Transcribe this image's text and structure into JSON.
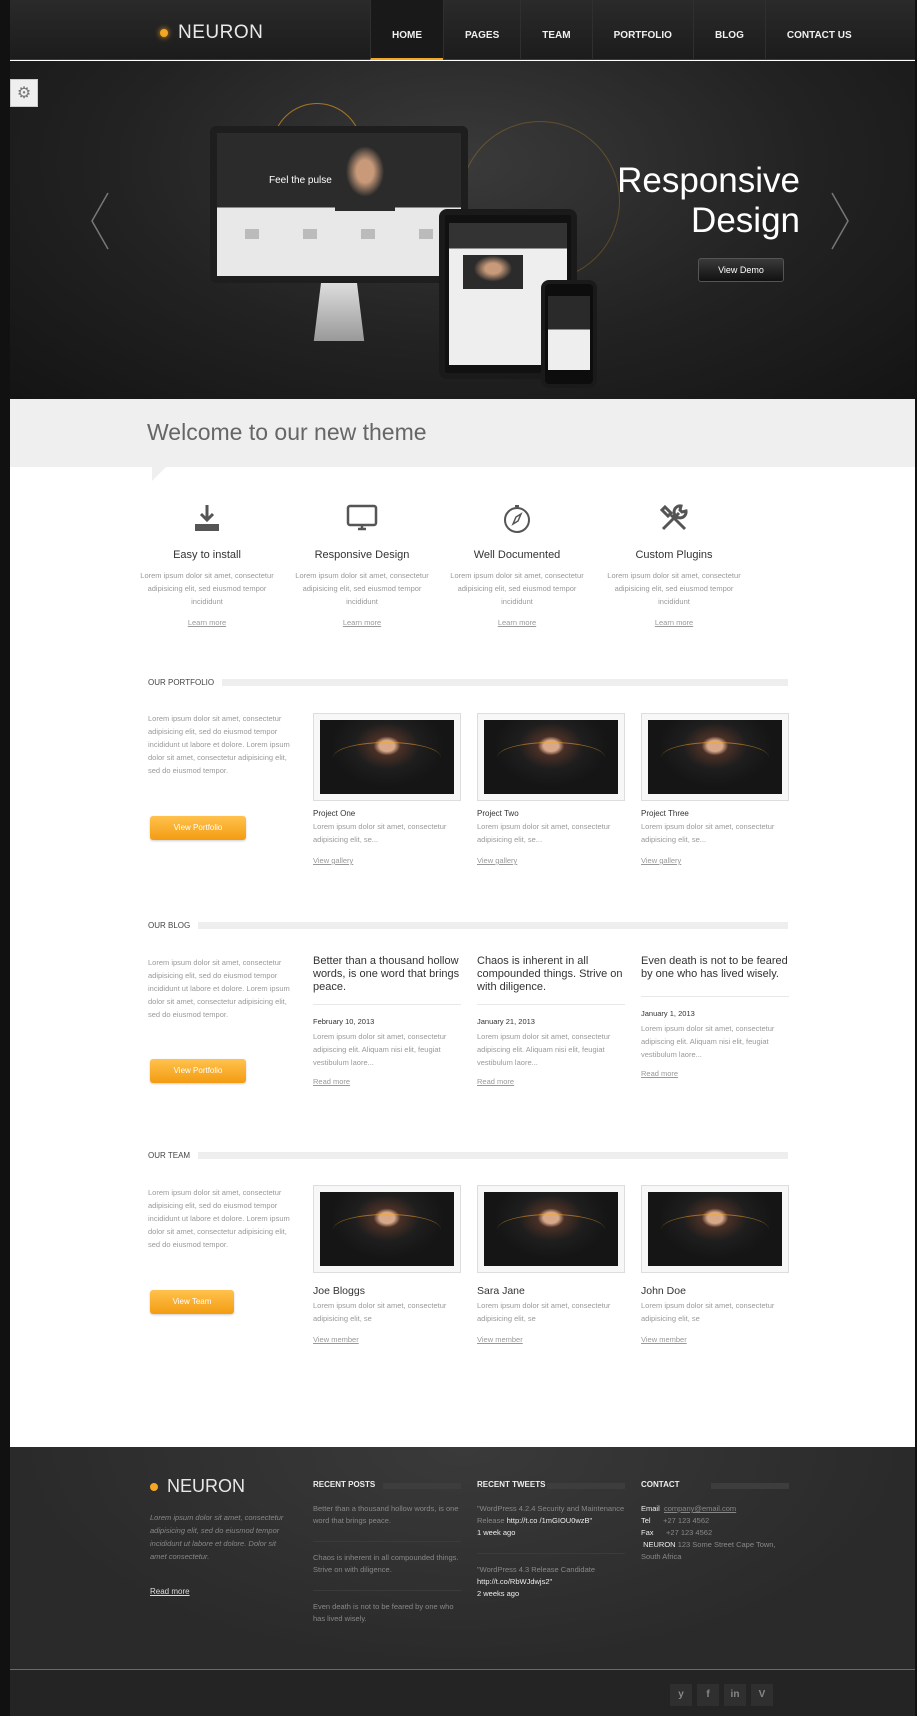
{
  "header": {
    "logo": "NEURON",
    "nav": [
      "HOME",
      "PAGES",
      "TEAM",
      "PORTFOLIO",
      "BLOG",
      "CONTACT US"
    ],
    "active_nav": "HOME"
  },
  "hero": {
    "title_line1": "Responsive",
    "title_line2": "Design",
    "button": "View Demo",
    "monitor_text": "Feel the pulse"
  },
  "welcome": {
    "title": "Welcome to our new theme"
  },
  "features": [
    {
      "title": "Easy to install",
      "text": "Lorem ipsum dolor sit amet, consectetur adipisicing elit, sed eiusmod tempor incididunt",
      "link": "Learn more",
      "icon": "download-icon"
    },
    {
      "title": "Responsive Design",
      "text": "Lorem ipsum dolor sit amet, consectetur adipisicing elit, sed eiusmod tempor incididunt",
      "link": "Learn more",
      "icon": "monitor-icon"
    },
    {
      "title": "Well Documented",
      "text": "Lorem ipsum dolor sit amet, consectetur adipisicing elit, sed eiusmod tempor incididunt",
      "link": "Learn more",
      "icon": "compass-icon"
    },
    {
      "title": "Custom Plugins",
      "text": "Lorem ipsum dolor sit amet, consectetur adipisicing elit, sed eiusmod tempor incididunt",
      "link": "Learn more",
      "icon": "tools-icon"
    }
  ],
  "portfolio": {
    "heading": "OUR PORTFOLIO",
    "intro": "Lorem ipsum dolor sit amet, consectetur adipisicing elit, sed do eiusmod tempor incididunt ut labore et dolore. Lorem ipsum dolor sit amet, consectetur adipisicing elit, sed do eiusmod tempor.",
    "button": "View Portfolio",
    "items": [
      {
        "name": "Project One",
        "text": "Lorem ipsum dolor sit amet, consectetur adipisicing elit, se...",
        "link": "View gallery"
      },
      {
        "name": "Project Two",
        "text": "Lorem ipsum dolor sit amet, consectetur adipisicing elit, se...",
        "link": "View gallery"
      },
      {
        "name": "Project Three",
        "text": "Lorem ipsum dolor sit amet, consectetur adipisicing elit, se...",
        "link": "View gallery"
      }
    ]
  },
  "blog": {
    "heading": "OUR BLOG",
    "intro": "Lorem ipsum dolor sit amet, consectetur adipisicing elit, sed do eiusmod tempor incididunt ut labore et dolore. Lorem ipsum dolor sit amet, consectetur adipisicing elit, sed do eiusmod tempor.",
    "button": "View Portfolio",
    "posts": [
      {
        "title": "Better than a thousand hollow words, is one word that brings peace.",
        "date": "February 10, 2013",
        "text": "Lorem ipsum dolor sit amet, consectetur adipiscing elit. Aliquam nisi elit, feugiat vestibulum laore...",
        "link": "Read more"
      },
      {
        "title": "Chaos is inherent in all compounded things. Strive on with diligence.",
        "date": "January 21, 2013",
        "text": "Lorem ipsum dolor sit amet, consectetur adipiscing elit. Aliquam nisi elit, feugiat vestibulum laore...",
        "link": "Read more"
      },
      {
        "title": "Even death is not to be feared by one who has lived wisely.",
        "date": "January 1, 2013",
        "text": "Lorem ipsum dolor sit amet, consectetur adipiscing elit. Aliquam nisi elit, feugiat vestibulum laore...",
        "link": "Read more"
      }
    ]
  },
  "team": {
    "heading": "OUR TEAM",
    "intro": "Lorem ipsum dolor sit amet, consectetur adipisicing elit, sed do eiusmod tempor incididunt ut labore et dolore. Lorem ipsum dolor sit amet, consectetur adipisicing elit, sed do eiusmod tempor.",
    "button": "View Team",
    "members": [
      {
        "name": "Joe Bloggs",
        "text": "Lorem ipsum dolor sit amet, consectetur adipisicing elit, se",
        "link": "View member"
      },
      {
        "name": "Sara Jane",
        "text": "Lorem ipsum dolor sit amet, consectetur adipisicing elit, se",
        "link": "View member"
      },
      {
        "name": "John Doe",
        "text": "Lorem ipsum dolor sit amet, consectetur adipisicing elit, se",
        "link": "View member"
      }
    ]
  },
  "footer": {
    "logo": "NEURON",
    "about": "Lorem ipsum dolor sit amet, consectetur adipisicing elit, sed do eiusmod tempor incididunt ut labore et dolore. Dolor sit amet consectetur.",
    "read_more": "Read more",
    "recent_posts": {
      "heading": "RECENT POSTS",
      "items": [
        "Better than a thousand hollow words, is one word that brings peace.",
        "Chaos is inherent in all compounded things. Strive on with diligence.",
        "Even death is not to be feared by one who has lived wisely."
      ]
    },
    "recent_tweets": {
      "heading": "RECENT TWEETS",
      "items": [
        {
          "text": "\"WordPress 4.2.4 Security and Maintenance Release ",
          "link": "http://t.co /1mGIOU0wzB\"",
          "time": "1 week ago"
        },
        {
          "text": "\"WordPress 4.3 Release Candidate ",
          "link": "http://t.co/RbWJdwjs2\"",
          "time": "2 weeks ago"
        }
      ]
    },
    "contact": {
      "heading": "CONTACT",
      "email_label": "Email",
      "email": "company@email.com",
      "tel_label": "Tel",
      "tel": "+27 123 4562",
      "fax_label": "Fax",
      "fax": "+27 123 4562",
      "company": "NEURON",
      "address": "123 Some Street Cape Town, South Africa"
    },
    "social": [
      "y",
      "f",
      "in",
      "V"
    ]
  },
  "colors": {
    "accent": "#f5a623",
    "dark": "#222222"
  }
}
